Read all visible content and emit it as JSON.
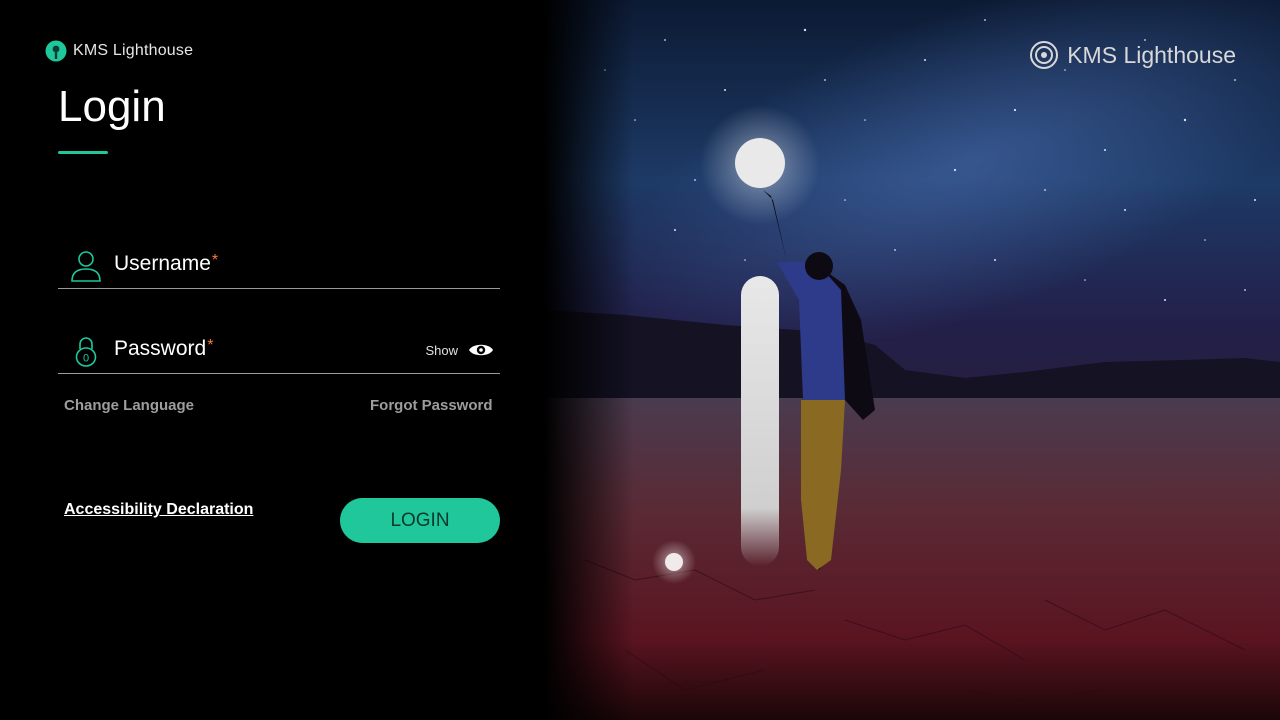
{
  "brand": {
    "name": "KMS Lighthouse"
  },
  "page": {
    "title": "Login"
  },
  "form": {
    "username_label": "Username",
    "password_label": "Password",
    "required_marker": "*",
    "show_label": "Show"
  },
  "links": {
    "change_language": "Change Language",
    "forgot_password": "Forgot Password",
    "accessibility": "Accessibility Declaration"
  },
  "buttons": {
    "login": "LOGIN"
  },
  "icons": {
    "brand_logo": "lighthouse-logo-icon",
    "username": "user-icon",
    "password": "lock-icon",
    "show_password": "eye-icon"
  },
  "colors": {
    "accent": "#1fc79a",
    "required": "#ff7a3d",
    "background": "#000000"
  }
}
